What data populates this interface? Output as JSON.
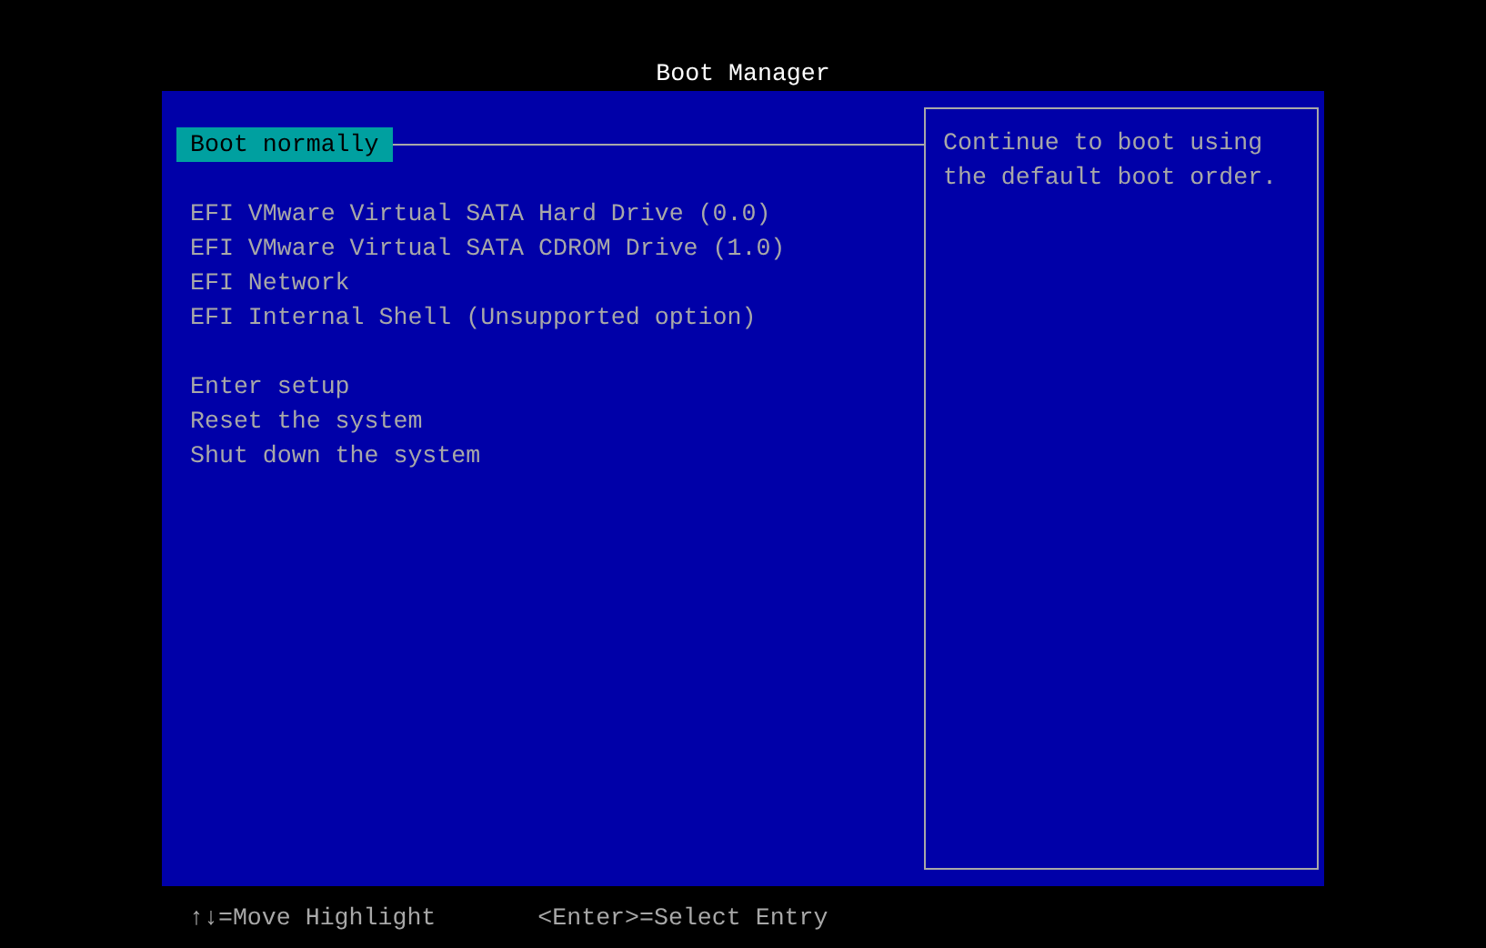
{
  "window": {
    "title": "Boot Manager"
  },
  "menu_groups": [
    {
      "items": [
        {
          "label": "Boot normally",
          "selected": true
        }
      ]
    },
    {
      "items": [
        {
          "label": "EFI VMware Virtual SATA Hard Drive (0.0)",
          "selected": false
        },
        {
          "label": "EFI VMware Virtual SATA CDROM Drive (1.0)",
          "selected": false
        },
        {
          "label": "EFI Network",
          "selected": false
        },
        {
          "label": "EFI Internal Shell (Unsupported option)",
          "selected": false
        }
      ]
    },
    {
      "items": [
        {
          "label": "Enter setup",
          "selected": false
        },
        {
          "label": "Reset the system",
          "selected": false
        },
        {
          "label": "Shut down the system",
          "selected": false
        }
      ]
    }
  ],
  "help": {
    "text": "Continue to boot using the default boot order."
  },
  "footer": {
    "hints": [
      "↑↓=Move Highlight",
      "<Enter>=Select Entry"
    ]
  }
}
